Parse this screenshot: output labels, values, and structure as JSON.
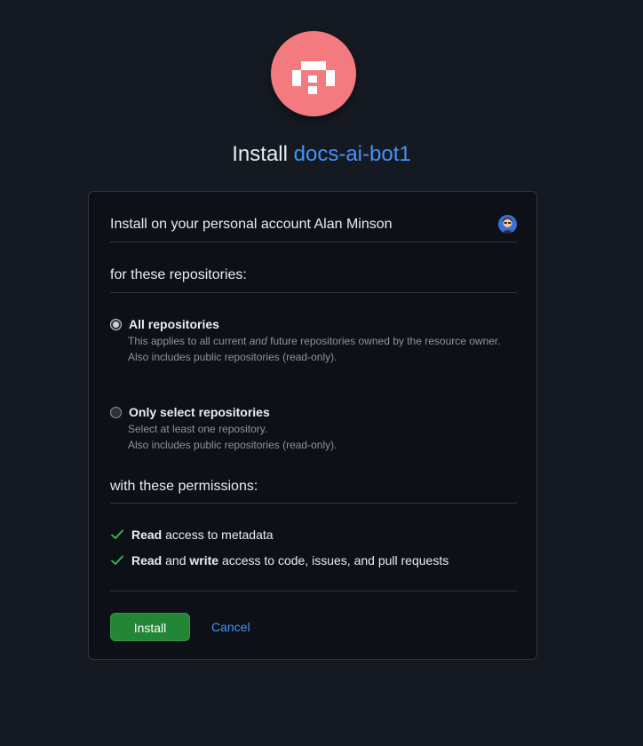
{
  "header": {
    "install_prefix": "Install",
    "app_name": "docs-ai-bot1"
  },
  "account": {
    "label": "Install on your personal account Alan Minson"
  },
  "repositories": {
    "title": "for these repositories:",
    "options": [
      {
        "label": "All repositories",
        "selected": true,
        "desc_part1": "This applies to all current",
        "desc_emphasis": "and",
        "desc_part2": "future repositories owned by the resource owner.",
        "desc_line2": "Also includes public repositories (read-only)."
      },
      {
        "label": "Only select repositories",
        "selected": false,
        "desc_line1": "Select at least one repository.",
        "desc_line2": "Also includes public repositories (read-only)."
      }
    ]
  },
  "permissions": {
    "title": "with these permissions:",
    "items": [
      {
        "bold1": "Read",
        "text1": "access to metadata"
      },
      {
        "bold1": "Read",
        "text1": "and",
        "bold2": "write",
        "text2": "access to code, issues, and pull requests"
      }
    ]
  },
  "actions": {
    "install_label": "Install",
    "cancel_label": "Cancel"
  },
  "icons": {
    "check": "check-icon",
    "logo": "app-logo-icon",
    "avatar": "user-avatar"
  },
  "colors": {
    "background": "#151a22",
    "card": "#0d1117",
    "accent_link": "#4493f8",
    "install_green": "#238636",
    "check_green": "#3fb950",
    "logo_pink": "#f37b80"
  }
}
